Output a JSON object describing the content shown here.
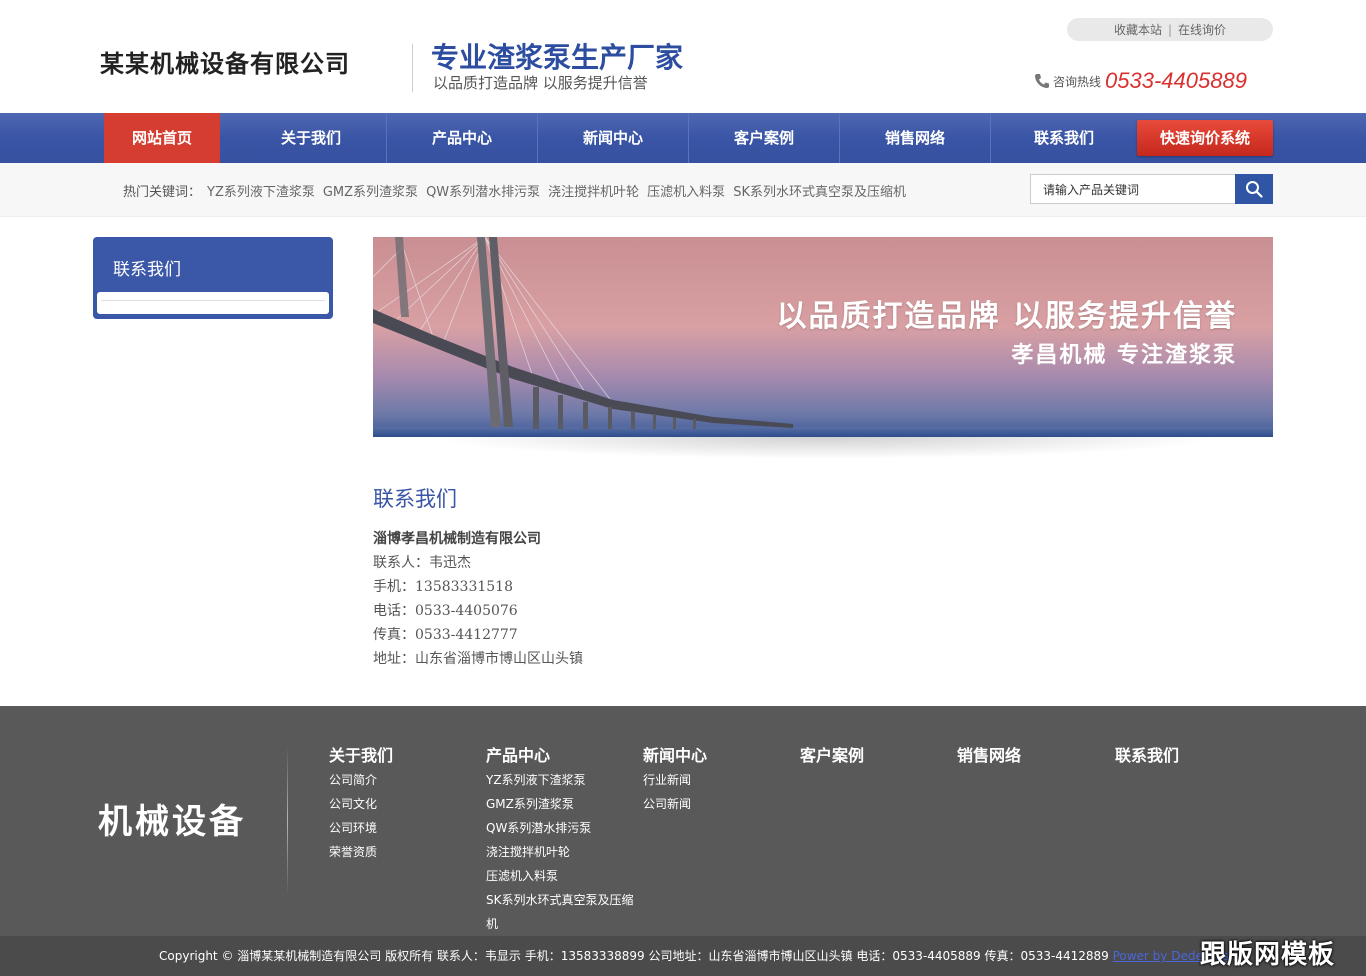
{
  "header": {
    "company_name": "某某机械设备有限公司",
    "slogan_title": "专业渣浆泵生产厂家",
    "slogan_sub": "以品质打造品牌  以服务提升信誉",
    "toplinks": {
      "bookmark": "收藏本站",
      "separator": "|",
      "inquiry": "在线询价"
    },
    "hotline_label": "咨询热线",
    "hotline_number": "0533-4405889"
  },
  "nav": {
    "items": [
      {
        "label": "网站首页",
        "active": true
      },
      {
        "label": "关于我们"
      },
      {
        "label": "产品中心"
      },
      {
        "label": "新闻中心"
      },
      {
        "label": "客户案例"
      },
      {
        "label": "销售网络"
      },
      {
        "label": "联系我们"
      }
    ],
    "quote_button": "快速询价系统"
  },
  "keywords": {
    "label": "热门关键词：",
    "items": [
      "YZ系列液下渣浆泵",
      "GMZ系列渣浆泵",
      "QW系列潜水排污泵",
      "浇注搅拌机叶轮",
      "压滤机入料泵",
      "SK系列水环式真空泵及压缩机"
    ]
  },
  "search": {
    "placeholder": "请输入产品关键词",
    "icon": "search-icon"
  },
  "sidebar": {
    "title": "联系我们"
  },
  "banner": {
    "title": "以品质打造品牌  以服务提升信誉",
    "subtitle": "孝昌机械  专注渣浆泵"
  },
  "content": {
    "title": "联系我们",
    "company": "淄博孝昌机械制造有限公司",
    "contact_person": "联系人：韦迅杰",
    "mobile": "手机：13583331518",
    "phone": "电话：0533-4405076",
    "fax": "传真：0533-4412777",
    "address": "地址：山东省淄博市博山区山头镇"
  },
  "footer": {
    "logo": "机械设备",
    "columns": [
      {
        "title": "关于我们",
        "links": [
          "公司简介",
          "公司文化",
          "公司环境",
          "荣誉资质"
        ]
      },
      {
        "title": "产品中心",
        "links": [
          "YZ系列液下渣浆泵",
          "GMZ系列渣浆泵",
          "QW系列潜水排污泵",
          "浇注搅拌机叶轮",
          "压滤机入料泵",
          "SK系列水环式真空泵及压缩机"
        ]
      },
      {
        "title": "新闻中心",
        "links": [
          "行业新闻",
          "公司新闻"
        ]
      },
      {
        "title": "客户案例",
        "links": []
      },
      {
        "title": "销售网络",
        "links": []
      },
      {
        "title": "联系我们",
        "links": []
      }
    ],
    "copyright": "Copyright © 淄博某某机械制造有限公司 版权所有 联系人：韦显示 手机：13583338899 公司地址：山东省淄博市博山区山头镇 电话：0533-4405889 传真：0533-4412889 ",
    "powered_link": "Power by DedeCms",
    "watermark": "跟版网模板"
  },
  "colors": {
    "brand_blue": "#3a55a5",
    "accent_red": "#d53d30",
    "hotline_red": "#d93030",
    "footer_gray": "#595959"
  }
}
